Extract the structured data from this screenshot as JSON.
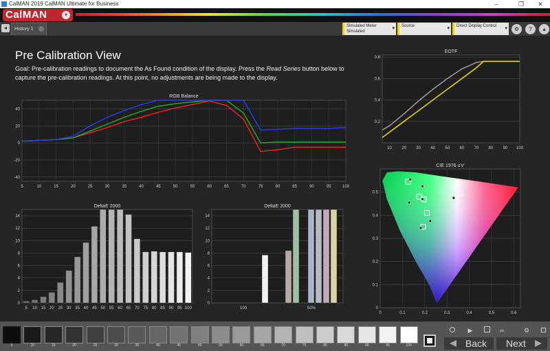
{
  "window": {
    "title": "CalMAN 2019 CalMAN Ultimate for Business",
    "minimize": "–",
    "restore": "❐",
    "close": "✕"
  },
  "app": {
    "logo": "CalMAN",
    "logo_caret": "▾"
  },
  "toolbar": {
    "nav_back": "◂",
    "tab_label": "History 1",
    "meter_line1": "Simulated Meter",
    "meter_line2": "Simulated",
    "source_label": "Source",
    "display_label": "Direct Display Control",
    "dropdown_arrow": "▾",
    "settings_icon": "gear-icon",
    "help_icon": "question-icon",
    "min_icon": "minimize-icon",
    "settings_glyph": "⚙",
    "help_glyph": "?",
    "collapse_glyph": "▴"
  },
  "page": {
    "title": "Pre Calibration View",
    "goal_part1": "Goal: Pre-calibration readings to document the As Found condition of the display. Press the ",
    "goal_emph": "Read Series",
    "goal_part2": " button below to capture the pre-calibration readings. At this point, no adjustments are being made to the display."
  },
  "colors": {
    "red": "#ff2020",
    "green": "#20b020",
    "blue": "#2040ff",
    "yellow": "#f2e200",
    "gray": "#a0a0a0",
    "accent": "#c0272d"
  },
  "chart_data": [
    {
      "type": "line",
      "title": "RGB Balance",
      "x": [
        5,
        10,
        15,
        20,
        25,
        30,
        35,
        40,
        45,
        50,
        55,
        60,
        65,
        70,
        75,
        80,
        85,
        90,
        95,
        100
      ],
      "xticks": [
        "5",
        "10",
        "15",
        "20",
        "25",
        "30",
        "35",
        "40",
        "45",
        "50",
        "55",
        "60",
        "65",
        "70",
        "75",
        "80",
        "85",
        "90",
        "95",
        "100"
      ],
      "yticks": [
        "40",
        "20",
        "0",
        "-20",
        "-40"
      ],
      "ylim": [
        -45,
        50
      ],
      "series": [
        {
          "color": "red",
          "values": [
            2,
            3,
            4,
            6,
            12,
            18,
            25,
            30,
            36,
            41,
            45,
            49,
            44,
            28,
            -10,
            -8,
            -5,
            -5,
            -5,
            -5
          ]
        },
        {
          "color": "green",
          "values": [
            2,
            3,
            4,
            6,
            14,
            22,
            30,
            37,
            43,
            46,
            48,
            50,
            50,
            35,
            0,
            1,
            1,
            1,
            1,
            1
          ]
        },
        {
          "color": "blue",
          "values": [
            2,
            3,
            4,
            8,
            20,
            30,
            38,
            45,
            50,
            50,
            50,
            50,
            50,
            50,
            15,
            16,
            17,
            17,
            17,
            18
          ]
        }
      ]
    },
    {
      "type": "bar",
      "title": "DeltaE 2000",
      "categories": [
        "5",
        "10",
        "15",
        "20",
        "25",
        "30",
        "35",
        "40",
        "45",
        "50",
        "55",
        "60",
        "65",
        "70",
        "75",
        "80",
        "85",
        "90",
        "95",
        "100"
      ],
      "values": [
        0.3,
        0.5,
        1.0,
        1.7,
        3.3,
        5.2,
        7.4,
        9.7,
        12.3,
        15,
        15,
        15,
        14.2,
        10.3,
        8.2,
        8.3,
        8.2,
        8.2,
        8.2,
        8.1
      ],
      "yticks": [
        "14",
        "12",
        "10",
        "8",
        "6",
        "4",
        "2",
        "0"
      ],
      "ylim": [
        0,
        15
      ]
    },
    {
      "type": "bar",
      "title": "DeltaE 2000",
      "categories": [
        "100",
        "50%"
      ],
      "values": [
        7.7,
        8.4,
        15,
        15,
        15,
        15,
        15
      ],
      "bar_colors": [
        "#f2f2f2",
        "#b8a8a8",
        "#9fc0a0",
        "#a8b4c8",
        "#b4bcc0",
        "#c0a8c0",
        "#d8d4a0"
      ],
      "yticks": [
        "14",
        "12",
        "10",
        "8",
        "6",
        "4",
        "2",
        "0"
      ],
      "ylim": [
        0,
        15
      ]
    },
    {
      "type": "line",
      "title": "EOTF",
      "x": [
        5,
        10,
        20,
        30,
        40,
        50,
        60,
        70,
        75,
        80,
        90,
        100
      ],
      "xticks": [
        "10",
        "20",
        "30",
        "40",
        "50",
        "60",
        "70",
        "80",
        "90",
        "100"
      ],
      "yticks": [
        "0.8",
        "0.6",
        "0.4",
        "0.2"
      ],
      "xlim": [
        5,
        100
      ],
      "ylim": [
        0,
        0.82
      ],
      "series": [
        {
          "color": "gray",
          "values": [
            0.12,
            0.16,
            0.27,
            0.39,
            0.5,
            0.6,
            0.69,
            0.75,
            0.76,
            0.76,
            0.76,
            0.76
          ]
        },
        {
          "color": "yellow",
          "values": [
            0.05,
            0.1,
            0.2,
            0.3,
            0.4,
            0.5,
            0.6,
            0.7,
            0.76,
            0.76,
            0.76,
            0.76
          ]
        }
      ]
    },
    {
      "type": "scatter",
      "title": "CIE 1976 u'v'",
      "xticks": [
        "0",
        "0.1",
        "0.2",
        "0.3",
        "0.4",
        "0.5",
        "0.6"
      ],
      "yticks": [
        "0.5",
        "0.4",
        "0.3",
        "0.2",
        "0.1",
        "0"
      ],
      "xlim": [
        0,
        0.63
      ],
      "ylim": [
        0,
        0.6
      ],
      "targets": [
        [
          0.125,
          0.545
        ],
        [
          0.175,
          0.48
        ],
        [
          0.196,
          0.468
        ],
        [
          0.36,
          0.495
        ],
        [
          0.21,
          0.41
        ],
        [
          0.193,
          0.35
        ]
      ],
      "measured": [
        [
          0.135,
          0.555
        ],
        [
          0.19,
          0.525
        ],
        [
          0.13,
          0.455
        ],
        [
          0.19,
          0.47
        ],
        [
          0.33,
          0.475
        ],
        [
          0.225,
          0.375
        ],
        [
          0.182,
          0.345
        ]
      ]
    }
  ],
  "swatches": [
    {
      "label": "5",
      "color": "#0d0d0d"
    },
    {
      "label": "10",
      "color": "#1a1a1a"
    },
    {
      "label": "15",
      "color": "#262626"
    },
    {
      "label": "20",
      "color": "#333333"
    },
    {
      "label": "25",
      "color": "#404040"
    },
    {
      "label": "30",
      "color": "#4d4d4d"
    },
    {
      "label": "35",
      "color": "#595959"
    },
    {
      "label": "40",
      "color": "#666666"
    },
    {
      "label": "45",
      "color": "#737373"
    },
    {
      "label": "50",
      "color": "#808080"
    },
    {
      "label": "55",
      "color": "#8c8c8c"
    },
    {
      "label": "60",
      "color": "#999999"
    },
    {
      "label": "65",
      "color": "#a6a6a6"
    },
    {
      "label": "70",
      "color": "#b3b3b3"
    },
    {
      "label": "75",
      "color": "#bfbfbf"
    },
    {
      "label": "80",
      "color": "#cccccc"
    },
    {
      "label": "85",
      "color": "#d9d9d9"
    },
    {
      "label": "90",
      "color": "#e6e6e6"
    },
    {
      "label": "95",
      "color": "#f2f2f2"
    },
    {
      "label": "100",
      "color": "#ffffff"
    }
  ],
  "controls": {
    "play": "▶",
    "stop_glyph": "■",
    "save": "💾",
    "loop": "∞",
    "back_label": "Back",
    "next_label": "Next"
  }
}
